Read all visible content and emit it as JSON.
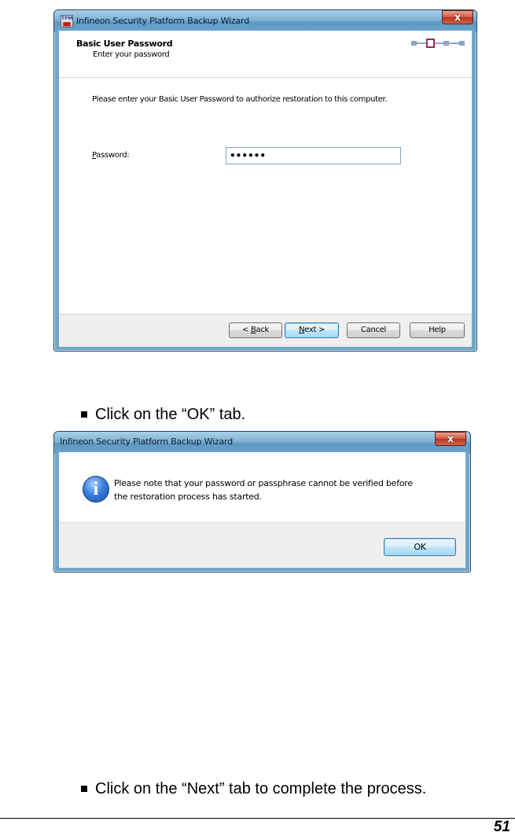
{
  "wizard": {
    "title": "Infineon Security Platform Backup Wizard",
    "close_glyph": "x",
    "app_icon": "tpm-chip-icon",
    "header_title": "Basic User Password",
    "header_subtitle": "Enter your password",
    "step_indicator": {
      "total_steps": 4,
      "current_step": 2
    },
    "instruction": "Please enter your Basic  User Password to authorize restoration to this computer.",
    "password_label_accesskey": "P",
    "password_label_rest": "assword:",
    "password_value": "••••••",
    "buttons": {
      "back_pre": "< ",
      "back_key": "B",
      "back_rest": "ack",
      "next_key": "N",
      "next_rest": "ext >",
      "cancel": "Cancel",
      "help": "Help"
    }
  },
  "bullets": {
    "first": "Click on the “OK” tab.",
    "second": "Click on the “Next” tab to complete the process."
  },
  "message_box": {
    "title": "Infineon Security Platform Backup Wizard",
    "close_glyph": "x",
    "icon": "information-icon",
    "icon_glyph": "i",
    "line1": "Please note that your password or passphrase cannot be verified before",
    "line2": "the restoration process has started.",
    "ok_button": "OK"
  },
  "page_number": "51",
  "colors": {
    "title_bar": "#6ea7cf",
    "close_button": "#c84a33",
    "step_active_border": "#a02a5a",
    "default_button_border": "#3c7fb1"
  }
}
